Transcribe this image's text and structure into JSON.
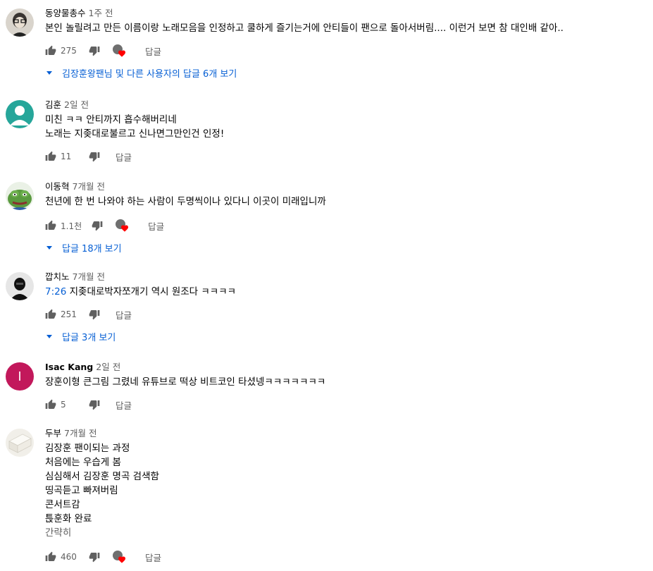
{
  "comments": [
    {
      "author": "동양물총수",
      "time": "1주 전",
      "lines": [
        "본인 놀릴려고 만든 이름이랑 노래모음을 인정하고 쿨하게 즐기는거에 안티들이 팬으로 돌아서버림.... 이런거 보면 참 대인배 같아.."
      ],
      "likes": "275",
      "reply": "답글",
      "replies": "김장훈왕팬님 및 다른 사용자의 답글 6개 보기"
    },
    {
      "author": "김훈",
      "time": "2일 전",
      "lines": [
        "미친 ㅋㅋ 안티까지 흡수해버리네",
        "노래는 지좆대로불르고  신나면그만인건 인정!"
      ],
      "likes": "11",
      "reply": "답글"
    },
    {
      "author": "이동혁",
      "time": "7개월 전",
      "lines": [
        "천년에 한 번 나와야 하는 사람이 두명씩이나 있다니 이곳이 미래입니까"
      ],
      "likes": "1.1천",
      "reply": "답글",
      "replies": "답글 18개 보기"
    },
    {
      "author": "깝치노",
      "time": "7개월 전",
      "timestamp": "7:26",
      "lines": [
        " 지좆대로박자쪼개기 역시 원조다 ㅋㅋㅋㅋ"
      ],
      "likes": "251",
      "reply": "답글",
      "replies": "답글 3개 보기"
    },
    {
      "author": "Isac Kang",
      "time": "2일 전",
      "lines": [
        "장훈이형 큰그림 그렸네 유튜브로 떡상 비트코인 타셨넹ㅋㅋㅋㅋㅋㅋㅋ"
      ],
      "likes": "5",
      "reply": "답글",
      "avatar_letter": "I"
    },
    {
      "author": "두부",
      "time": "7개월 전",
      "lines": [
        "김장훈 팬이되는 과정",
        "처음에는 우습게 봄",
        "심심해서 김장훈 명곡 검색함",
        "띵곡듣고 빠져버림",
        "콘서트감",
        "튽훈화 완료"
      ],
      "more": "간략히",
      "likes": "460",
      "reply": "답글"
    }
  ],
  "colors": {
    "link": "#065fd4",
    "secondary": "#606060",
    "heart": "#ff0000",
    "isac_avatar": "#c2185b",
    "kimhun_avatar": "#26a69a"
  },
  "icons": [
    "like-icon",
    "dislike-icon",
    "heart-icon",
    "caret-down-icon"
  ]
}
